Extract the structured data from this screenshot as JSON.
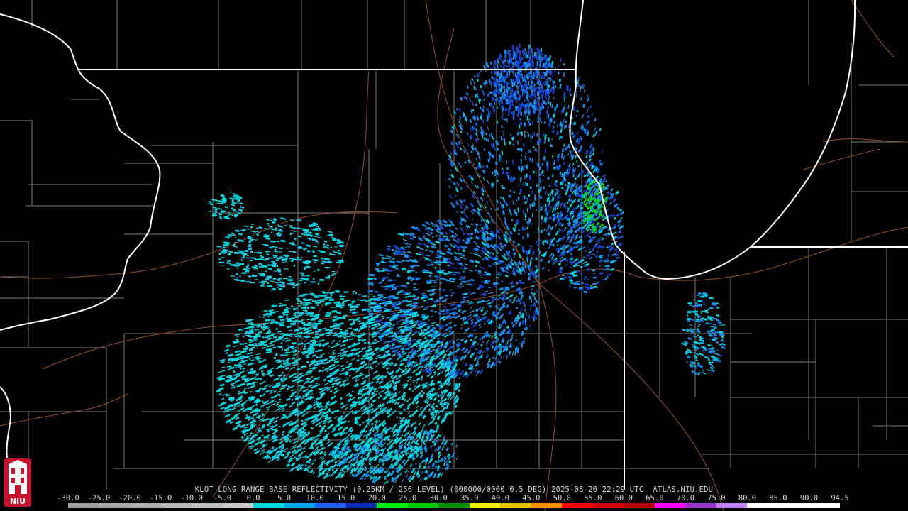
{
  "product": {
    "caption": "KLOT LONG RANGE BASE REFLECTIVITY (0.25KM / 256 LEVEL) (000000/0000 0.5 DEG) 2025-08-20 22:29 UTC  ATLAS.NIU.EDU"
  },
  "logo": {
    "text": "NIU",
    "icon": "university-tower-logo"
  },
  "legend": {
    "unit_scale": [
      "-30.0",
      "-25.0",
      "-20.0",
      "-15.0",
      "-10.0",
      "-5.0",
      "0.0",
      "5.0",
      "10.0",
      "15.0",
      "20.0",
      "25.0",
      "30.0",
      "35.0",
      "40.0",
      "45.0",
      "50.0",
      "55.0",
      "60.0",
      "65.0",
      "70.0",
      "75.0",
      "80.0",
      "85.0",
      "90.0",
      "94.5"
    ],
    "colors": [
      "#a0a0a0",
      "#a8a8a8",
      "#b0b0b0",
      "#b8b8b8",
      "#c0c0c0",
      "#c8c8c8",
      "#00d7e0",
      "#00a6e8",
      "#1a63f0",
      "#0a2db4",
      "#00f000",
      "#00c800",
      "#009000",
      "#f0f000",
      "#e8c000",
      "#ff9000",
      "#ff0000",
      "#d00000",
      "#b00000",
      "#ff00ff",
      "#9a32cd",
      "#c080ff",
      "#ffffff",
      "#ffffff",
      "#ffffff"
    ]
  },
  "map_colors": {
    "background": "#000000",
    "state_borders": "#ffffff",
    "county_lines": "#8a8a8a",
    "highways": "#8a4a2a",
    "echo_light": "#00d7e0",
    "echo_medium": "#1a8cf0",
    "echo_dark": "#1446d8",
    "echo_green": "#00e000"
  }
}
